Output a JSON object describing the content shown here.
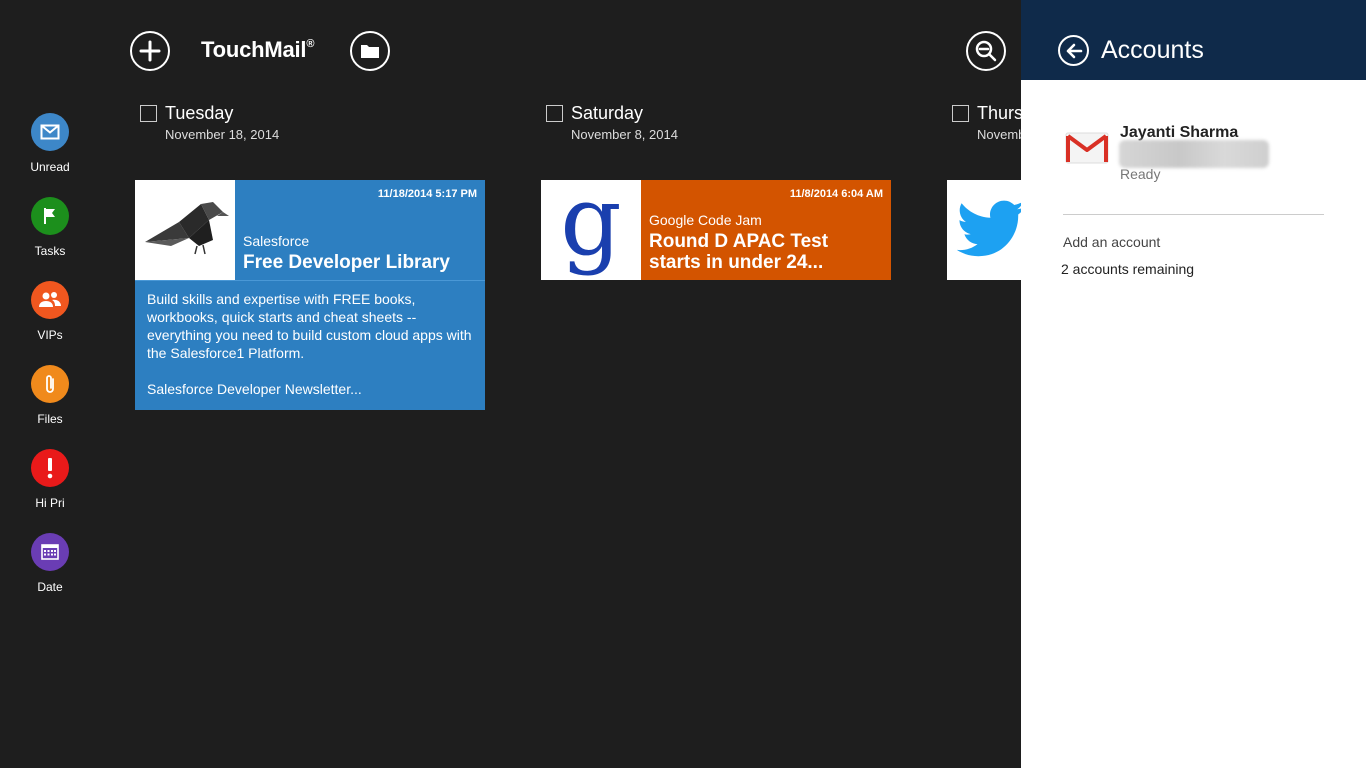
{
  "app": {
    "logo_text": "TouchMail",
    "logo_mark": "®"
  },
  "sidebar": {
    "items": [
      {
        "label": "Unread",
        "color": "#3d87c8",
        "icon": "envelope-icon"
      },
      {
        "label": "Tasks",
        "color": "#1c8f1c",
        "icon": "flag-icon"
      },
      {
        "label": "VIPs",
        "color": "#f0571f",
        "icon": "people-icon"
      },
      {
        "label": "Files",
        "color": "#f08a1c",
        "icon": "paperclip-icon"
      },
      {
        "label": "Hi Pri",
        "color": "#e91a1a",
        "icon": "exclamation-icon"
      },
      {
        "label": "Date",
        "color": "#6a3db4",
        "icon": "calendar-icon"
      }
    ]
  },
  "columns": [
    {
      "day": "Tuesday",
      "date": "November 18, 2014"
    },
    {
      "day": "Saturday",
      "date": "November 8, 2014"
    },
    {
      "day": "Thursday",
      "date": "November"
    }
  ],
  "cards": [
    {
      "time": "11/18/2014 5:17 PM",
      "sender": "Salesforce",
      "subject": "Free Developer Library",
      "body": "Build skills and expertise with FREE books, workbooks, quick starts and cheat sheets -- everything you need to build custom cloud apps with the Salesforce1 Platform.",
      "footer": "Salesforce Developer Newsletter...",
      "color": "#2d7fc1",
      "icon": "origami-bird-icon"
    },
    {
      "time": "11/8/2014 6:04 AM",
      "sender": "Google Code Jam",
      "subject": "Round D APAC Test starts in under 24...",
      "color": "#d35400",
      "icon": "google-g-icon"
    },
    {
      "color": "#ffffff",
      "icon": "twitter-bird-icon"
    }
  ],
  "accounts_panel": {
    "title": "Accounts",
    "account": {
      "name": "Jayanti Sharma",
      "status": "Ready",
      "icon": "gmail-icon"
    },
    "add_account": "Add an account",
    "remaining": "2 accounts remaining"
  }
}
